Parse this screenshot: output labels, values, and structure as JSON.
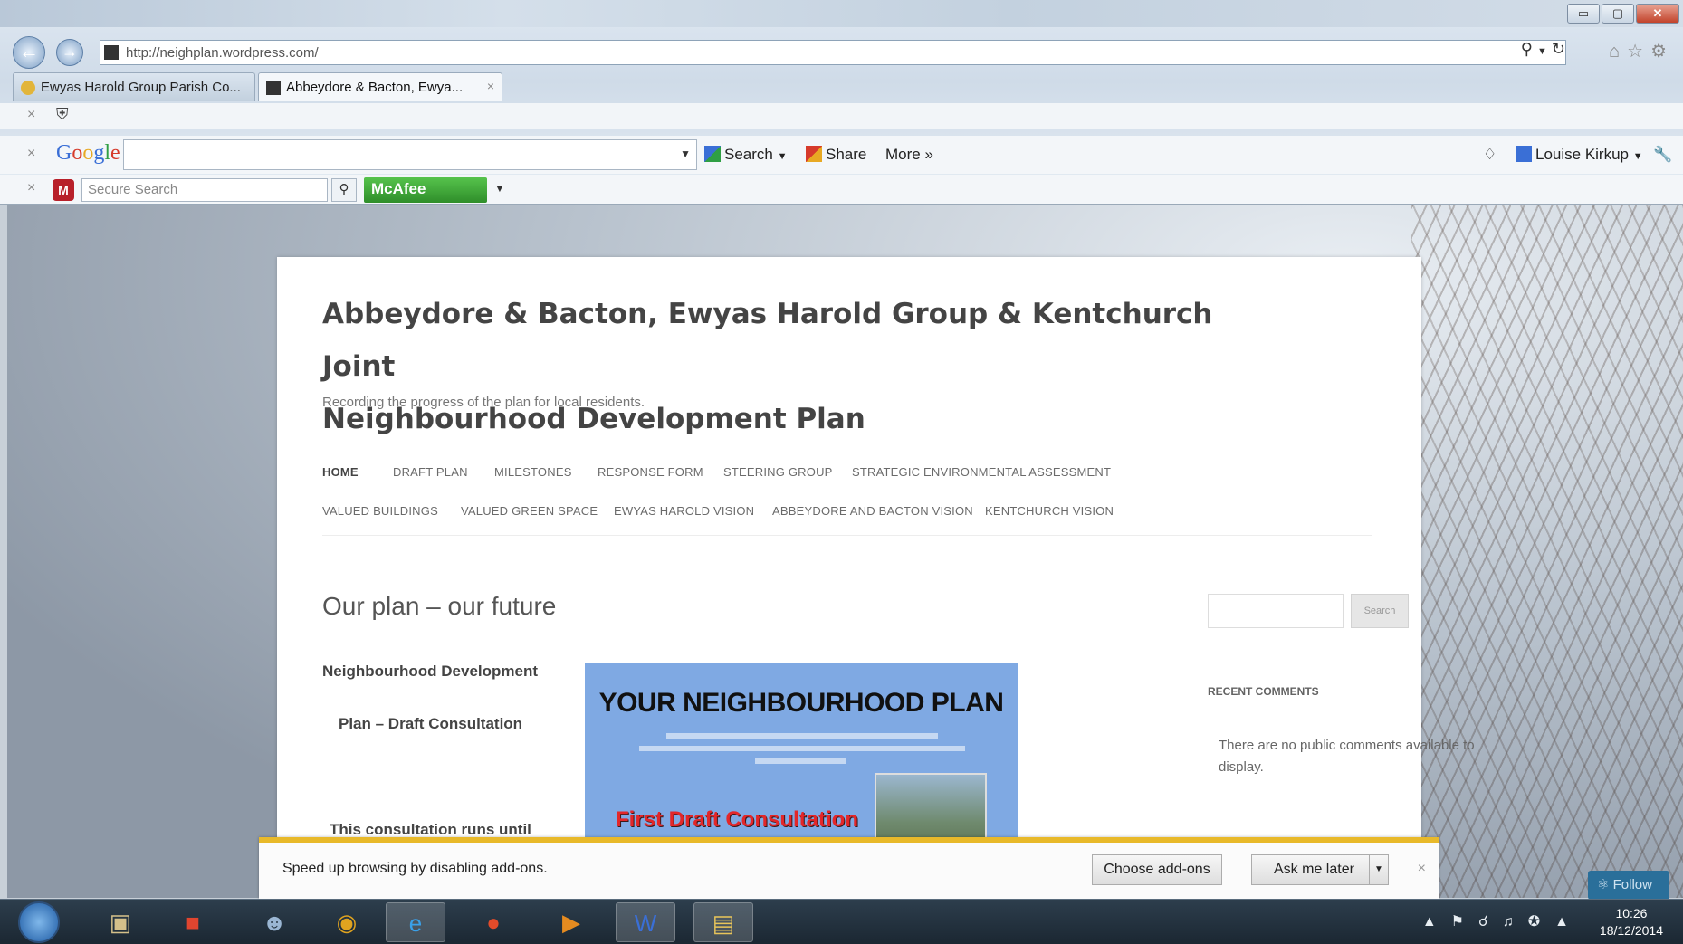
{
  "browser": {
    "address_url": "http://neighplan.wordpress.com/",
    "tabs": [
      {
        "label": "Ewyas Harold Group Parish Co..."
      },
      {
        "label": "Abbeydore & Bacton, Ewya...",
        "close": "×"
      }
    ],
    "google_toolbar": {
      "logo": {
        "G": "G",
        "o1": "o",
        "o2": "o",
        "g": "g",
        "l": "l",
        "e": "e"
      },
      "search_label": "Search",
      "share_label": "Share",
      "more_label": "More »",
      "user_label": "Louise Kirkup"
    },
    "mcafee_toolbar": {
      "search_placeholder": "Secure Search",
      "brand_label": "McAfee"
    },
    "window_buttons": {
      "minimize": "▭",
      "maximize": "▢",
      "close": "✕"
    },
    "toolbar_close": "×"
  },
  "site": {
    "title_line1": "Abbeydore & Bacton, Ewyas Harold Group & Kentchurch Joint",
    "title_line2": "Neighbourhood Development Plan",
    "description": "Recording the progress of the plan for local residents.",
    "nav": [
      "HOME",
      "DRAFT PLAN",
      "MILESTONES",
      "RESPONSE FORM",
      "STEERING GROUP",
      "STRATEGIC ENVIRONMENTAL ASSESSMENT",
      "VALUED BUILDINGS",
      "VALUED GREEN SPACE",
      "EWYAS HAROLD VISION",
      "ABBEYDORE AND BACTON VISION",
      "KENTCHURCH VISION"
    ],
    "entry_title": "Our plan – our future",
    "content_line1": "Neighbourhood Development",
    "content_line2": "Plan – Draft Consultation",
    "content_line3": "This consultation runs until",
    "poster": {
      "title": "YOUR NEIGHBOURHOOD PLAN",
      "red_text": "First Draft Consultation"
    },
    "sidebar": {
      "search_button": "Search",
      "recent_comments_title": "RECENT COMMENTS",
      "recent_comments_text": "There are no public comments available to display."
    },
    "follow_label": "Follow"
  },
  "notification": {
    "text": "Speed up browsing by disabling add-ons.",
    "choose_button": "Choose add-ons",
    "later_button": "Ask me later",
    "close": "×"
  },
  "taskbar": {
    "time": "10:26",
    "date": "18/12/2014"
  }
}
